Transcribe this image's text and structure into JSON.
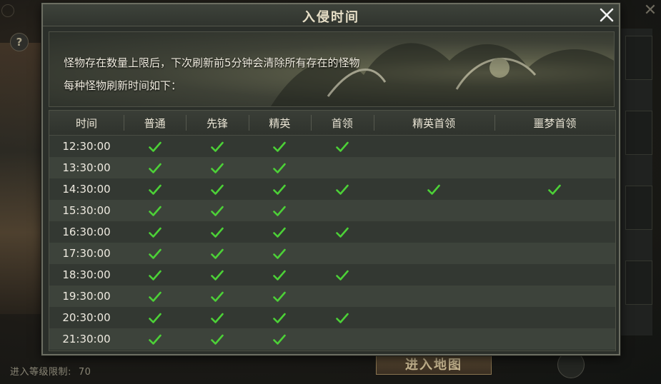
{
  "background": {
    "help_label": "?",
    "level_label": "进入等级限制:",
    "level_value": "70",
    "enter_button_label": "进入地图"
  },
  "dialog": {
    "title": "入侵时间",
    "close_label": "×",
    "info_line1": "怪物存在数量上限后，下次刷新前5分钟会清除所有存在的怪物",
    "info_line2": "每种怪物刷新时间如下：",
    "columns": [
      "时间",
      "普通",
      "先锋",
      "精英",
      "首领",
      "精英首领",
      "噩梦首领"
    ],
    "rows": [
      {
        "time": "12:30:00",
        "checks": [
          true,
          true,
          true,
          true,
          false,
          false
        ]
      },
      {
        "time": "13:30:00",
        "checks": [
          true,
          true,
          true,
          false,
          false,
          false
        ]
      },
      {
        "time": "14:30:00",
        "checks": [
          true,
          true,
          true,
          true,
          true,
          true
        ]
      },
      {
        "time": "15:30:00",
        "checks": [
          true,
          true,
          true,
          false,
          false,
          false
        ]
      },
      {
        "time": "16:30:00",
        "checks": [
          true,
          true,
          true,
          true,
          false,
          false
        ]
      },
      {
        "time": "17:30:00",
        "checks": [
          true,
          true,
          true,
          false,
          false,
          false
        ]
      },
      {
        "time": "18:30:00",
        "checks": [
          true,
          true,
          true,
          true,
          false,
          false
        ]
      },
      {
        "time": "19:30:00",
        "checks": [
          true,
          true,
          true,
          false,
          false,
          false
        ]
      },
      {
        "time": "20:30:00",
        "checks": [
          true,
          true,
          true,
          true,
          false,
          false
        ]
      },
      {
        "time": "21:30:00",
        "checks": [
          true,
          true,
          true,
          false,
          false,
          false
        ]
      }
    ],
    "check_icon": "check-icon",
    "check_color": "#4cd137"
  }
}
